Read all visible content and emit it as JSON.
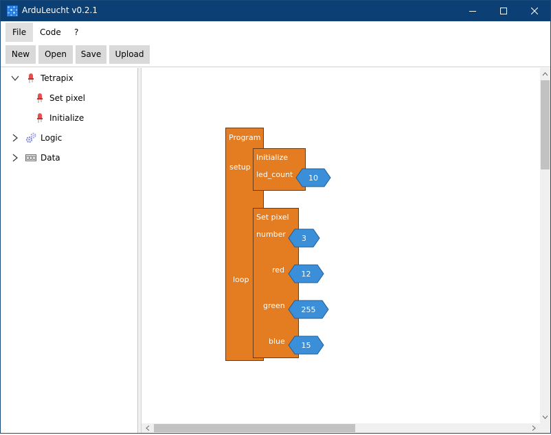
{
  "window": {
    "title": "ArduLeucht v0.2.1",
    "accent_color": "#0c3f73"
  },
  "menu": {
    "items": [
      {
        "label": "File"
      },
      {
        "label": "Code"
      },
      {
        "label": "?"
      }
    ]
  },
  "toolbar": {
    "new_label": "New",
    "open_label": "Open",
    "save_label": "Save",
    "upload_label": "Upload"
  },
  "tree": {
    "items": [
      {
        "label": "Tetrapix",
        "icon": "led-icon",
        "expanded": true
      },
      {
        "label": "Set pixel",
        "icon": "led-icon"
      },
      {
        "label": "Initialize",
        "icon": "led-icon"
      },
      {
        "label": "Logic",
        "icon": "gears-icon",
        "expanded": false
      },
      {
        "label": "Data",
        "icon": "number-icon",
        "expanded": false
      }
    ]
  },
  "canvas": {
    "block_color": "#e47d22",
    "value_color": "#3a8fd8",
    "program": {
      "title": "Program",
      "setup_label": "setup",
      "loop_label": "loop"
    },
    "initialize": {
      "title": "Initialize",
      "param_label": "led_count",
      "param_value": "10"
    },
    "set_pixel": {
      "title": "Set pixel",
      "params": [
        {
          "label": "number",
          "value": "3"
        },
        {
          "label": "red",
          "value": "12"
        },
        {
          "label": "green",
          "value": "255"
        },
        {
          "label": "blue",
          "value": "15"
        }
      ]
    }
  }
}
